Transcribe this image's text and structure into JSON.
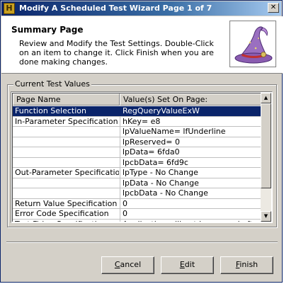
{
  "window": {
    "title": "Modify A Scheduled Test Wizard Page 1 of 7",
    "close_label": "✕"
  },
  "header": {
    "title": "Summary Page",
    "description": "Review and Modify the Test Settings. Double-Click on an item to change it.  Click Finish when you are done making changes."
  },
  "group": {
    "label": "Current Test Values"
  },
  "table": {
    "columns": [
      "Page Name",
      "Value(s) Set On Page:"
    ],
    "rows": [
      {
        "name": "Function Selection",
        "value": "RegQueryValueExW",
        "selected": true
      },
      {
        "name": "In-Parameter Specification",
        "value": "hKey= e8"
      },
      {
        "name": "",
        "value": "lpValueName= lfUnderline"
      },
      {
        "name": "",
        "value": "lpReserved= 0"
      },
      {
        "name": "",
        "value": "lpData= 6fda0"
      },
      {
        "name": "",
        "value": "lpcbData= 6fd9c"
      },
      {
        "name": "Out-Parameter Specification",
        "value": "lpType - No Change"
      },
      {
        "name": "",
        "value": "lpData - No Change"
      },
      {
        "name": "",
        "value": "lpcbData - No Change"
      },
      {
        "name": "Return Value Specification",
        "value": "0"
      },
      {
        "name": "Error Code Specification",
        "value": "0"
      },
      {
        "name": "Test Firing Specification",
        "value": "Application will not be paused after test"
      }
    ]
  },
  "buttons": {
    "cancel": {
      "mnemonic": "C",
      "rest": "ancel"
    },
    "edit": {
      "mnemonic": "E",
      "rest": "dit"
    },
    "finish": {
      "mnemonic": "F",
      "rest": "inish"
    }
  },
  "scrollbar": {
    "up_icon": "▲",
    "down_icon": "▼"
  },
  "colors": {
    "selection": "#0a246a",
    "dialog_face": "#d4d0c8"
  }
}
